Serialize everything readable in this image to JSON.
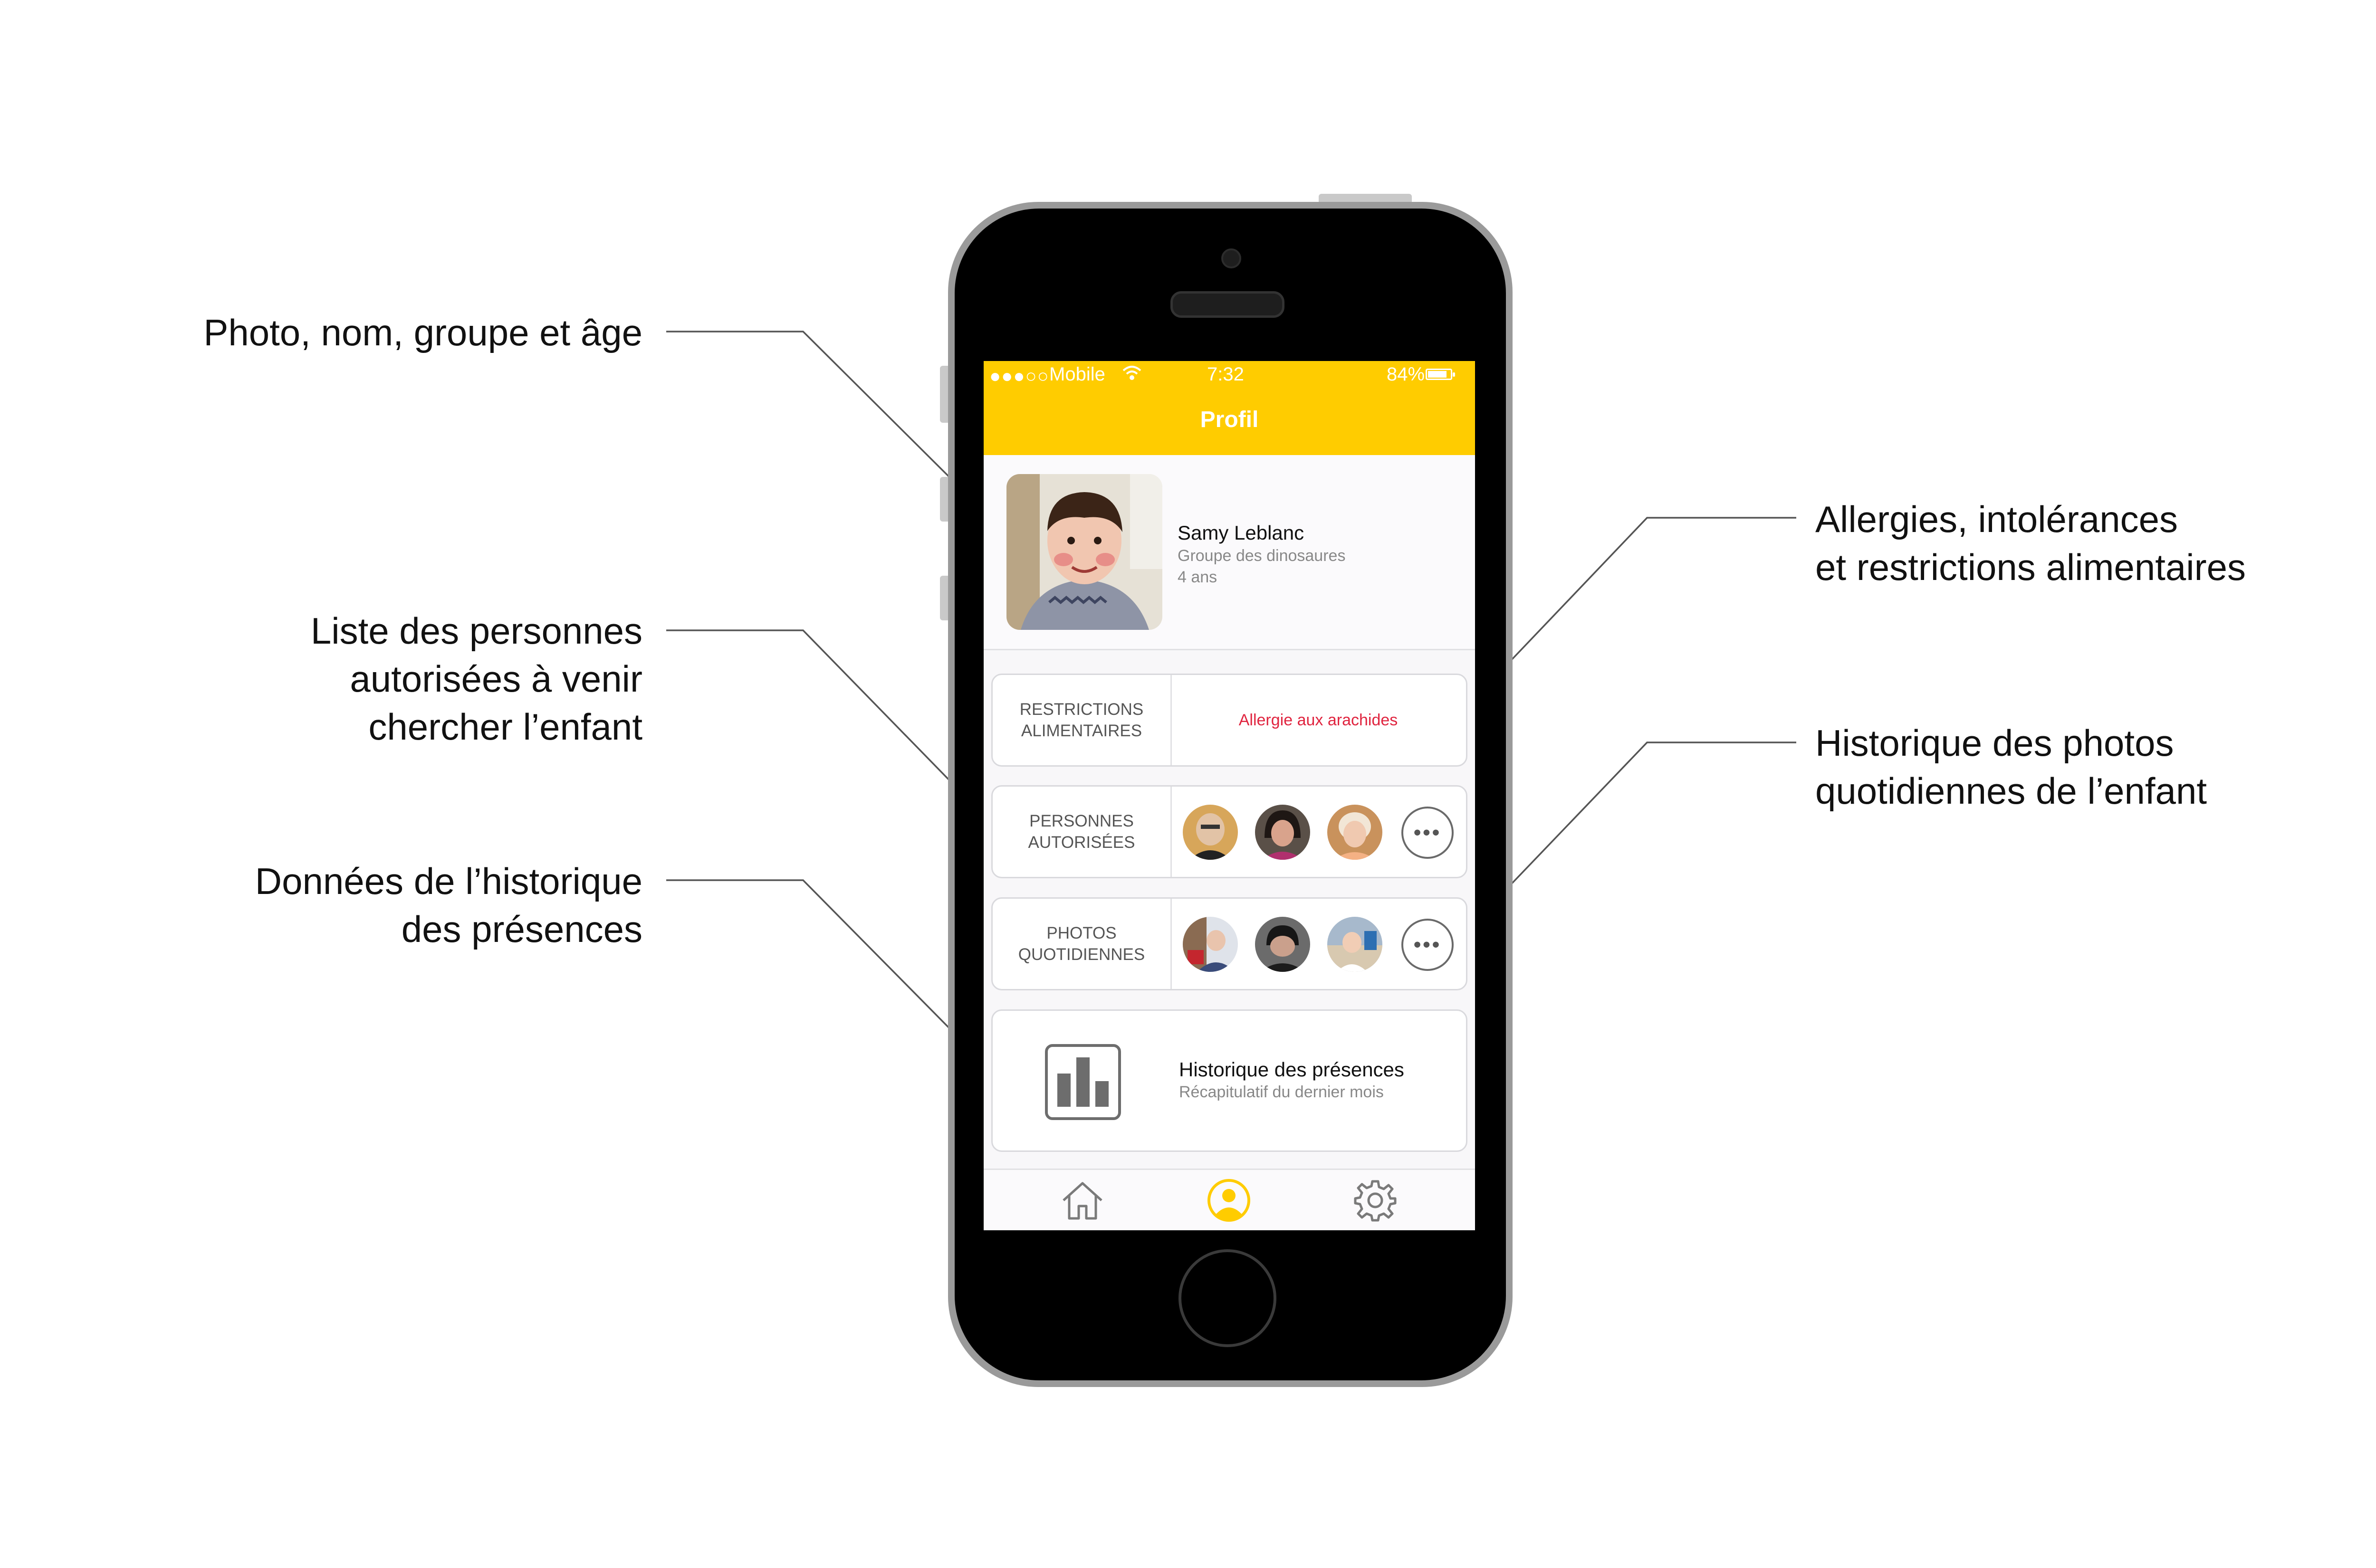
{
  "annotations": {
    "photo": [
      "Photo, nom, groupe et âge"
    ],
    "persons": [
      "Liste des personnes",
      "autorisées à venir",
      "chercher l’enfant"
    ],
    "presence": [
      "Données de l’historique",
      "des présences"
    ],
    "allergies": [
      "Allergies, intolérances",
      "et restrictions alimentaires"
    ],
    "photos": [
      "Historique des photos",
      "quotidiennes de l’enfant"
    ]
  },
  "status_bar": {
    "signal": "●●●○○",
    "carrier": "Mobile",
    "time": "7:32",
    "battery": "84%",
    "battery_level": 0.84
  },
  "nav": {
    "title": "Profil"
  },
  "profile": {
    "name": "Samy Leblanc",
    "group": "Groupe des dinosaures",
    "age": "4 ans"
  },
  "restrictions": {
    "label": [
      "RESTRICTIONS",
      "ALIMENTAIRES"
    ],
    "value": "Allergie aux arachides"
  },
  "persons": {
    "label": [
      "PERSONNES",
      "AUTORISÉES"
    ],
    "more": "•••"
  },
  "photos": {
    "label": [
      "PHOTOS",
      "QUOTIDIENNES"
    ],
    "more": "•••"
  },
  "history": {
    "title": "Historique des présences",
    "subtitle": "Récapitulatif du dernier mois"
  },
  "tabs": [
    {
      "icon": "home-icon",
      "active": false
    },
    {
      "icon": "profile-icon",
      "active": true
    },
    {
      "icon": "gear-icon",
      "active": false
    }
  ],
  "colors": {
    "accent": "#ffcc00",
    "allergy": "#e0243f",
    "inactive_icon": "#7a7a7a"
  }
}
